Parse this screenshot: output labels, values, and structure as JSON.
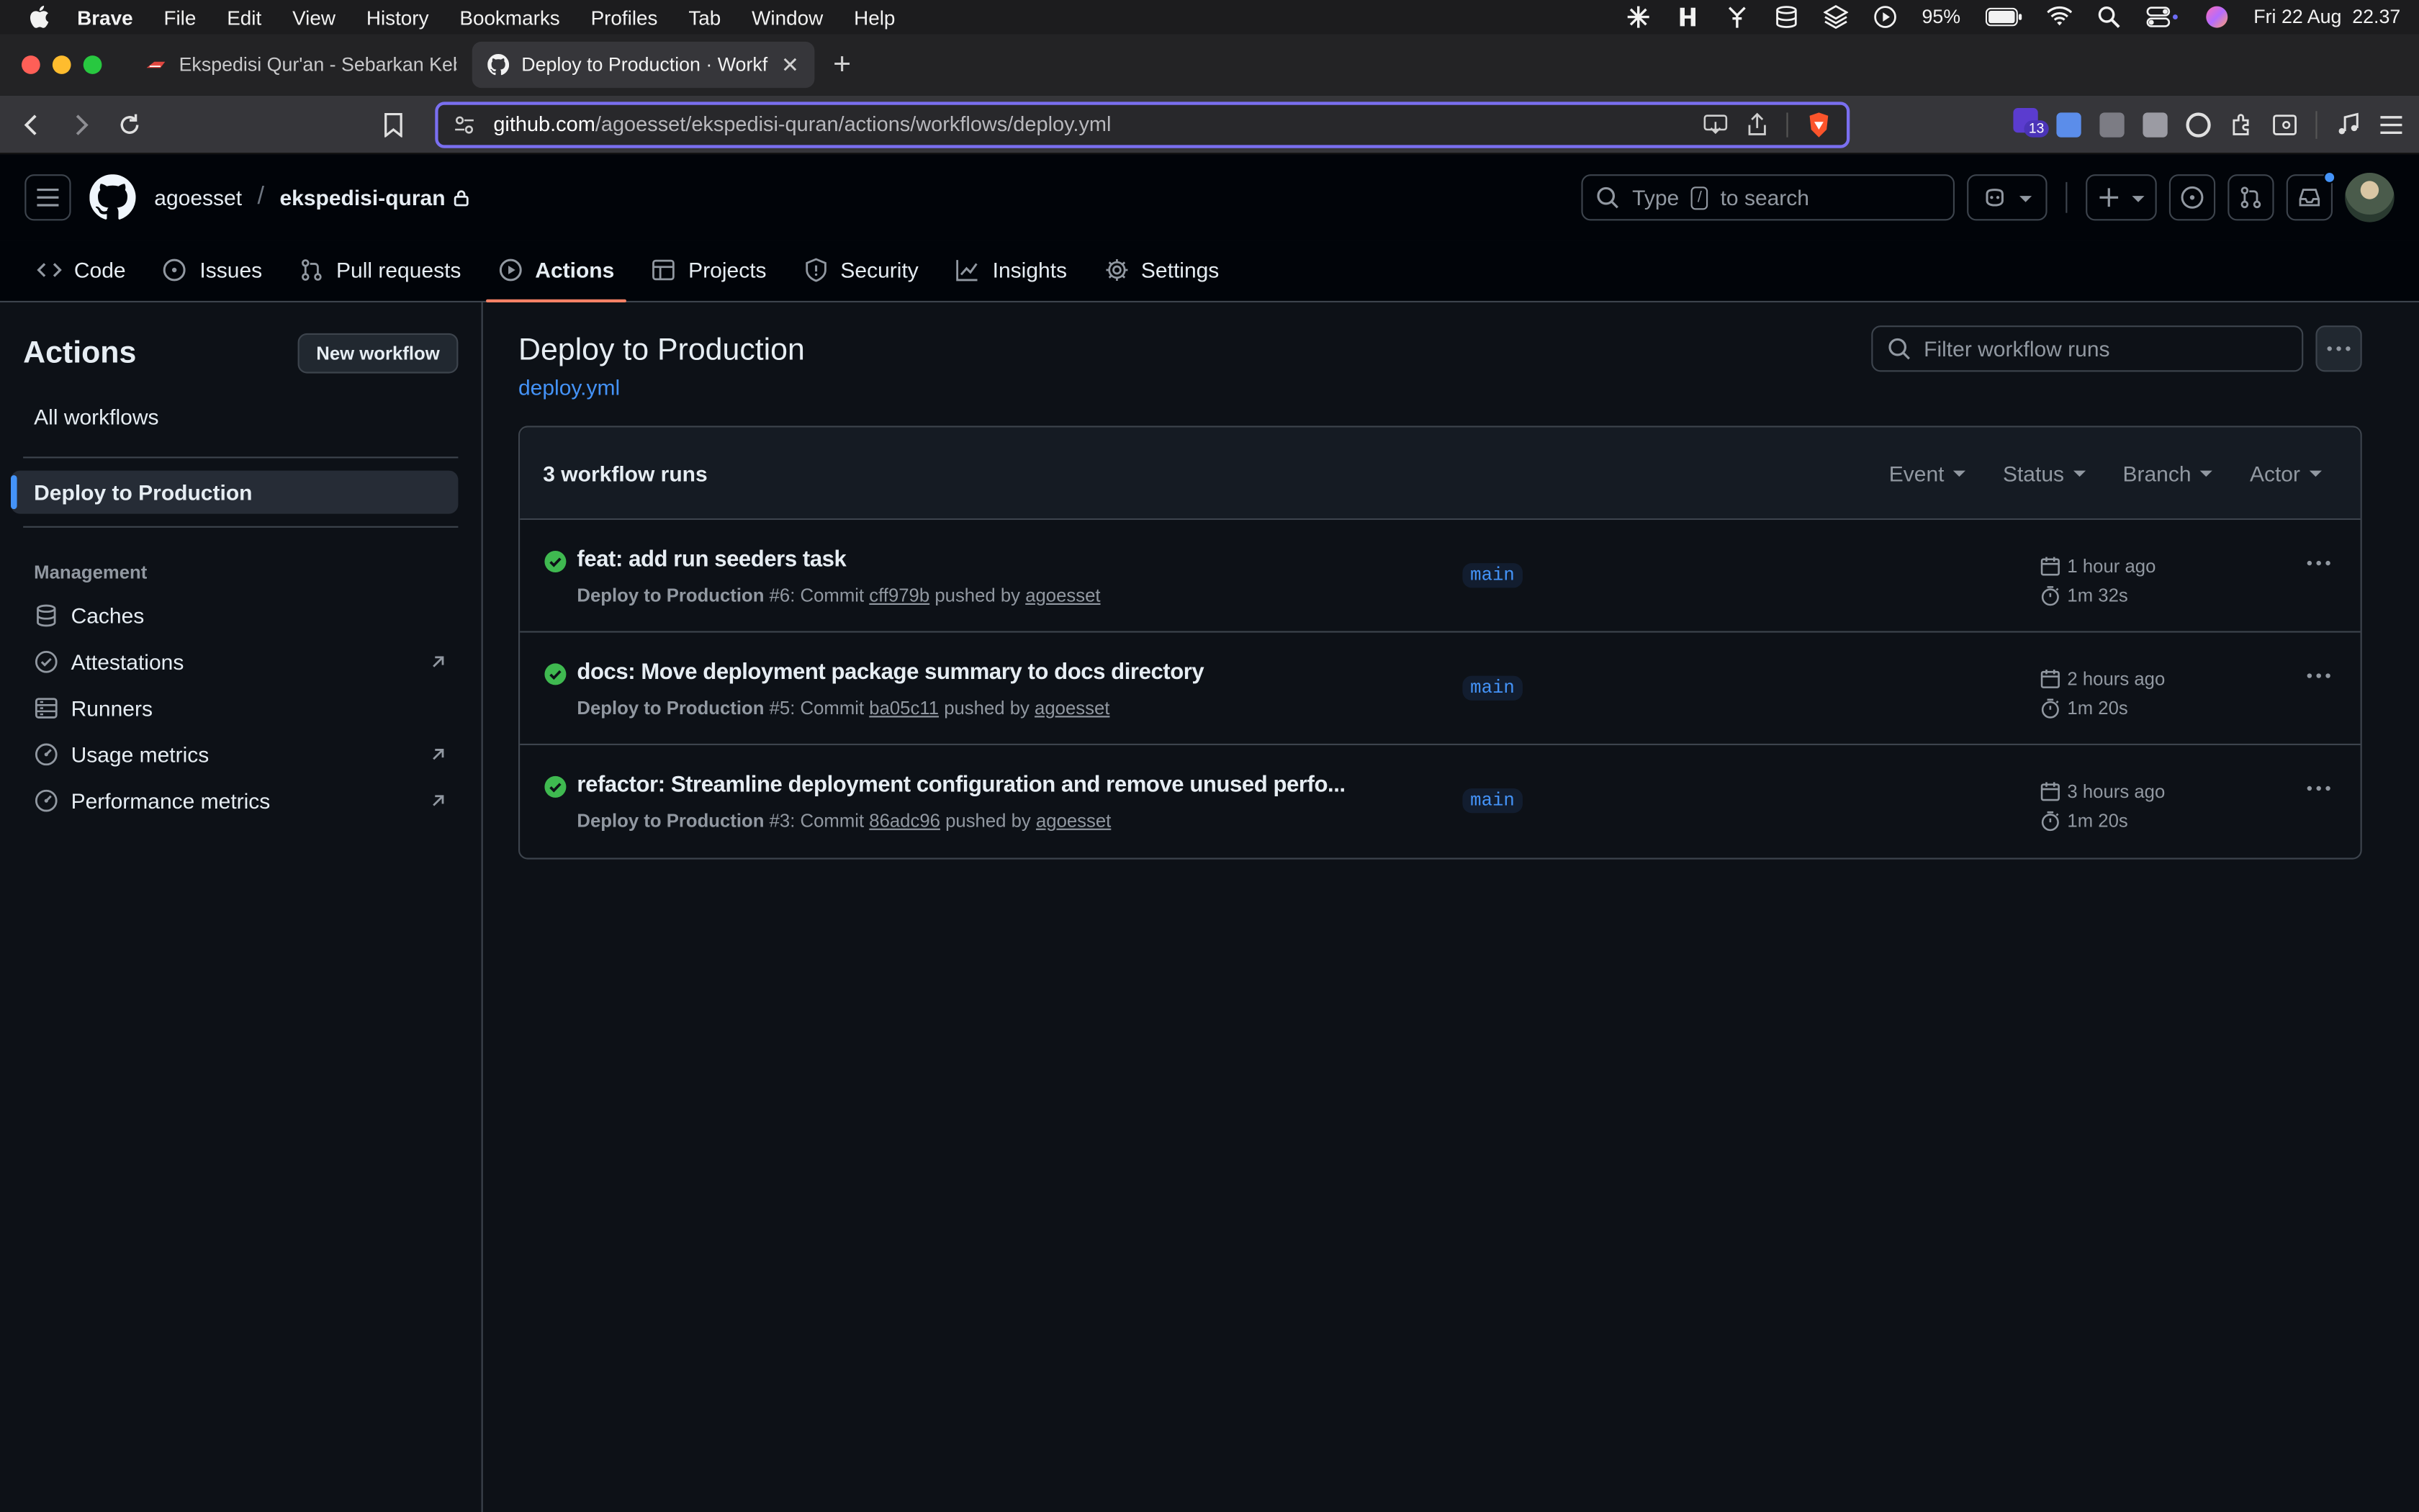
{
  "menubar": {
    "app": "Brave",
    "items": [
      "File",
      "Edit",
      "View",
      "History",
      "Bookmarks",
      "Profiles",
      "Tab",
      "Window",
      "Help"
    ],
    "battery": "95%",
    "datetime": "Fri 22 Aug  22.37"
  },
  "browser": {
    "tabs": [
      {
        "title": "Ekspedisi Qur'an - Sebarkan Kebai",
        "active": false
      },
      {
        "title": "Deploy to Production · Workflo",
        "active": true
      }
    ],
    "url_host": "github.com",
    "url_path": "/agoesset/ekspedisi-quran/actions/workflows/deploy.yml",
    "extension_badge": "13"
  },
  "github": {
    "owner": "agoesset",
    "repo": "ekspedisi-quran",
    "search_prefix": "Type",
    "search_key": "/",
    "search_suffix": "to search",
    "nav": [
      {
        "label": "Code",
        "icon": "code-icon"
      },
      {
        "label": "Issues",
        "icon": "issue-icon"
      },
      {
        "label": "Pull requests",
        "icon": "pull-request-icon"
      },
      {
        "label": "Actions",
        "icon": "play-icon",
        "active": true
      },
      {
        "label": "Projects",
        "icon": "table-icon"
      },
      {
        "label": "Security",
        "icon": "shield-icon"
      },
      {
        "label": "Insights",
        "icon": "graph-icon"
      },
      {
        "label": "Settings",
        "icon": "gear-icon"
      }
    ]
  },
  "sidebar": {
    "title": "Actions",
    "new_workflow": "New workflow",
    "all_workflows": "All workflows",
    "active_workflow": "Deploy to Production",
    "management_heading": "Management",
    "management": [
      {
        "label": "Caches",
        "icon": "database-icon",
        "external": false
      },
      {
        "label": "Attestations",
        "icon": "verified-icon",
        "external": true
      },
      {
        "label": "Runners",
        "icon": "server-icon",
        "external": false
      },
      {
        "label": "Usage metrics",
        "icon": "meter-icon",
        "external": true
      },
      {
        "label": "Performance metrics",
        "icon": "meter-icon",
        "external": true
      }
    ]
  },
  "workflow": {
    "title": "Deploy to Production",
    "file": "deploy.yml",
    "filter_placeholder": "Filter workflow runs",
    "runs_count": "3 workflow runs",
    "filters": [
      "Event",
      "Status",
      "Branch",
      "Actor"
    ],
    "runs": [
      {
        "title": "feat: add run seeders task",
        "workflow": "Deploy to Production",
        "number": "#6",
        "commit_label": ": Commit",
        "commit": "cff979b",
        "pushed_by": "pushed by",
        "actor": "agoesset",
        "branch": "main",
        "when": "1 hour ago",
        "duration": "1m 32s",
        "status": "success"
      },
      {
        "title": "docs: Move deployment package summary to docs directory",
        "workflow": "Deploy to Production",
        "number": "#5",
        "commit_label": ": Commit",
        "commit": "ba05c11",
        "pushed_by": "pushed by",
        "actor": "agoesset",
        "branch": "main",
        "when": "2 hours ago",
        "duration": "1m 20s",
        "status": "success"
      },
      {
        "title": "refactor: Streamline deployment configuration and remove unused perfo...",
        "workflow": "Deploy to Production",
        "number": "#3",
        "commit_label": ": Commit",
        "commit": "86adc96",
        "pushed_by": "pushed by",
        "actor": "agoesset",
        "branch": "main",
        "when": "3 hours ago",
        "duration": "1m 20s",
        "status": "success"
      }
    ]
  },
  "colors": {
    "accent_link": "#4493f8",
    "success": "#3fb950",
    "active_tab_underline": "#f78166",
    "url_focus": "#7a6ff0"
  }
}
